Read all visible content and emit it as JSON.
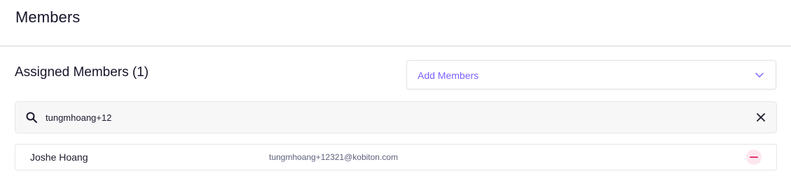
{
  "header": {
    "title": "Members"
  },
  "section": {
    "title": "Assigned Members (1)"
  },
  "add_members": {
    "label": "Add Members",
    "icon": "chevron-down-icon",
    "accent_color": "#7b61ff"
  },
  "search": {
    "value": "tungmhoang+12",
    "icon": "search-icon",
    "clear_icon": "close-icon"
  },
  "members": [
    {
      "name": "Joshe Hoang",
      "email": "tungmhoang+12321@kobiton.com",
      "remove_icon": "minus-icon",
      "remove_color": "#e8336d"
    }
  ]
}
